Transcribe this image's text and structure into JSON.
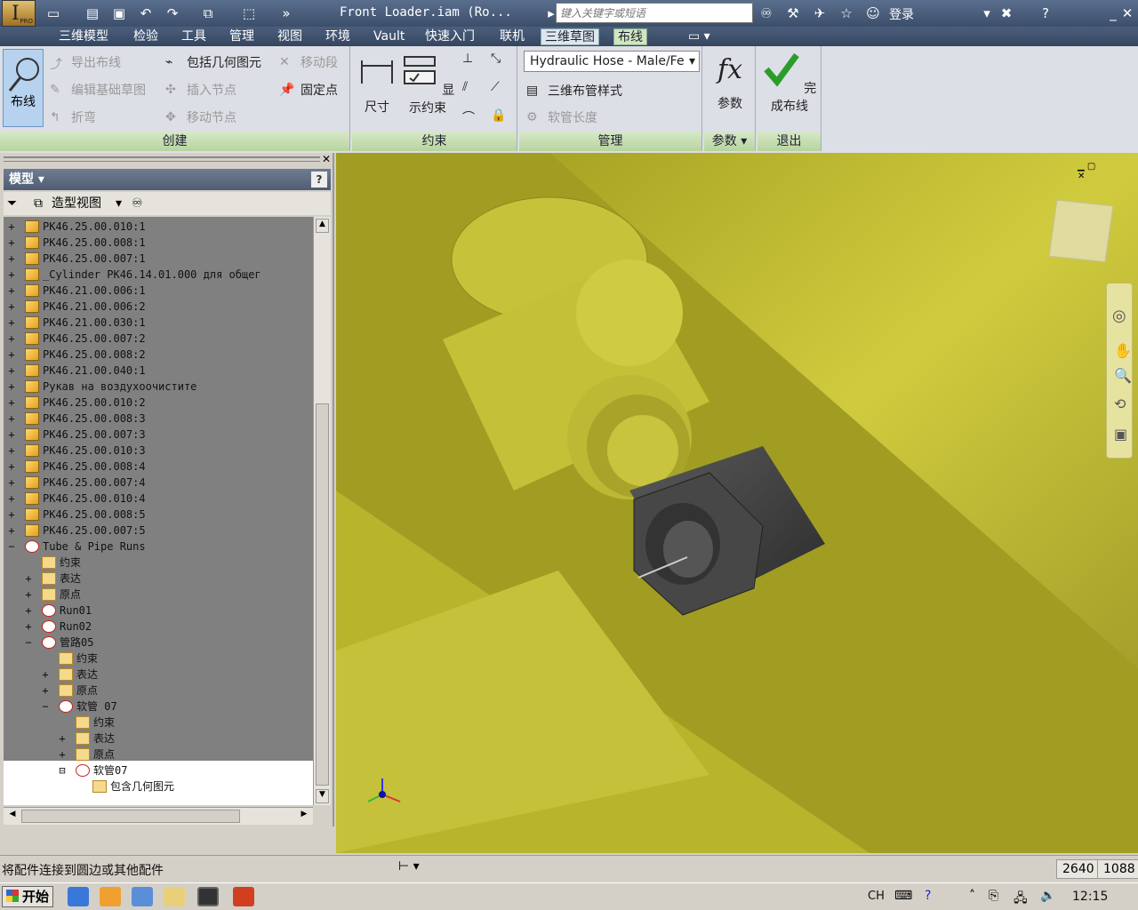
{
  "window": {
    "title": "Front Loader.iam (Ro...",
    "search_placeholder": "键入关键字或短语",
    "login": "登录",
    "logo_badge": "PRO"
  },
  "tabs": [
    "三维模型",
    "检验",
    "工具",
    "管理",
    "视图",
    "环境",
    "Vault",
    "快速入门",
    "联机",
    "三维草图",
    "布线"
  ],
  "ribbon": {
    "create": {
      "label": "创建",
      "layout_button": "布线",
      "export_route": "导出布线",
      "edit_base_sketch": "编辑基础草图",
      "bend": "折弯",
      "include_geometry": "包括几何图元",
      "insert_node": "插入节点",
      "move_node": "移动节点",
      "move_segment": "移动段",
      "fixed_point": "固定点"
    },
    "constrain": {
      "label": "约束",
      "dimension": "尺寸",
      "show_constraints": "显示约束"
    },
    "manage": {
      "label": "管理",
      "hose_style": "Hydraulic Hose - Male/Fe",
      "tube_pipe_style": "三维布管样式",
      "hose_length": "软管长度"
    },
    "params": {
      "label": "参数",
      "button": "参数"
    },
    "exit": {
      "label": "退出",
      "button": "完成布线"
    }
  },
  "browser": {
    "header": "模型",
    "view_mode": "造型视图",
    "tree": [
      {
        "label": "PK46.25.00.010:1",
        "indent": 0,
        "icon": "part",
        "exp": "+"
      },
      {
        "label": "PK46.25.00.008:1",
        "indent": 0,
        "icon": "part",
        "exp": "+"
      },
      {
        "label": "PK46.25.00.007:1",
        "indent": 0,
        "icon": "part",
        "exp": "+"
      },
      {
        "label": "_Cylinder PK46.14.01.000 для общег",
        "indent": 0,
        "icon": "part",
        "exp": "+"
      },
      {
        "label": "PK46.21.00.006:1",
        "indent": 0,
        "icon": "part",
        "exp": "+"
      },
      {
        "label": "PK46.21.00.006:2",
        "indent": 0,
        "icon": "part",
        "exp": "+"
      },
      {
        "label": "PK46.21.00.030:1",
        "indent": 0,
        "icon": "part",
        "exp": "+"
      },
      {
        "label": "PK46.25.00.007:2",
        "indent": 0,
        "icon": "part",
        "exp": "+"
      },
      {
        "label": "PK46.25.00.008:2",
        "indent": 0,
        "icon": "part",
        "exp": "+"
      },
      {
        "label": "PK46.21.00.040:1",
        "indent": 0,
        "icon": "part",
        "exp": "+"
      },
      {
        "label": "Рукав на воздухоочистите",
        "indent": 0,
        "icon": "part",
        "exp": "+"
      },
      {
        "label": "PK46.25.00.010:2",
        "indent": 0,
        "icon": "part",
        "exp": "+"
      },
      {
        "label": "PK46.25.00.008:3",
        "indent": 0,
        "icon": "part",
        "exp": "+"
      },
      {
        "label": "PK46.25.00.007:3",
        "indent": 0,
        "icon": "part",
        "exp": "+"
      },
      {
        "label": "PK46.25.00.010:3",
        "indent": 0,
        "icon": "part",
        "exp": "+"
      },
      {
        "label": "PK46.25.00.008:4",
        "indent": 0,
        "icon": "part",
        "exp": "+"
      },
      {
        "label": "PK46.25.00.007:4",
        "indent": 0,
        "icon": "part",
        "exp": "+"
      },
      {
        "label": "PK46.25.00.010:4",
        "indent": 0,
        "icon": "part",
        "exp": "+"
      },
      {
        "label": "PK46.25.00.008:5",
        "indent": 0,
        "icon": "part",
        "exp": "+"
      },
      {
        "label": "PK46.25.00.007:5",
        "indent": 0,
        "icon": "part",
        "exp": "+"
      },
      {
        "label": "Tube & Pipe Runs",
        "indent": 0,
        "icon": "run",
        "exp": "−"
      },
      {
        "label": "约束",
        "indent": 1,
        "icon": "folder",
        "exp": ""
      },
      {
        "label": "表达",
        "indent": 1,
        "icon": "folder",
        "exp": "+"
      },
      {
        "label": "原点",
        "indent": 1,
        "icon": "folder",
        "exp": "+"
      },
      {
        "label": "Run01",
        "indent": 1,
        "icon": "run",
        "exp": "+"
      },
      {
        "label": "Run02",
        "indent": 1,
        "icon": "run",
        "exp": "+"
      },
      {
        "label": "管路05",
        "indent": 1,
        "icon": "run",
        "exp": "−"
      },
      {
        "label": "约束",
        "indent": 2,
        "icon": "folder",
        "exp": ""
      },
      {
        "label": "表达",
        "indent": 2,
        "icon": "folder",
        "exp": "+"
      },
      {
        "label": "原点",
        "indent": 2,
        "icon": "folder",
        "exp": "+"
      },
      {
        "label": "软管 07",
        "indent": 2,
        "icon": "run",
        "exp": "−"
      },
      {
        "label": "约束",
        "indent": 3,
        "icon": "folder",
        "exp": ""
      },
      {
        "label": "表达",
        "indent": 3,
        "icon": "folder",
        "exp": "+"
      },
      {
        "label": "原点",
        "indent": 3,
        "icon": "folder",
        "exp": "+"
      },
      {
        "label": "软管07",
        "indent": 3,
        "icon": "run",
        "exp": "⊟"
      },
      {
        "label": "包含几何图元",
        "indent": 4,
        "icon": "folder",
        "exp": ""
      }
    ]
  },
  "status": {
    "message": "将配件连接到圆边或其他配件",
    "num1": "2640",
    "num2": "1088"
  },
  "taskbar": {
    "start": "开始",
    "lang": "CH",
    "clock": "12:15"
  },
  "colors": {
    "viewport_yellow": "#c6c23a",
    "ribbon_group_label": "#b7d49e",
    "tree_bg": "#808080"
  }
}
